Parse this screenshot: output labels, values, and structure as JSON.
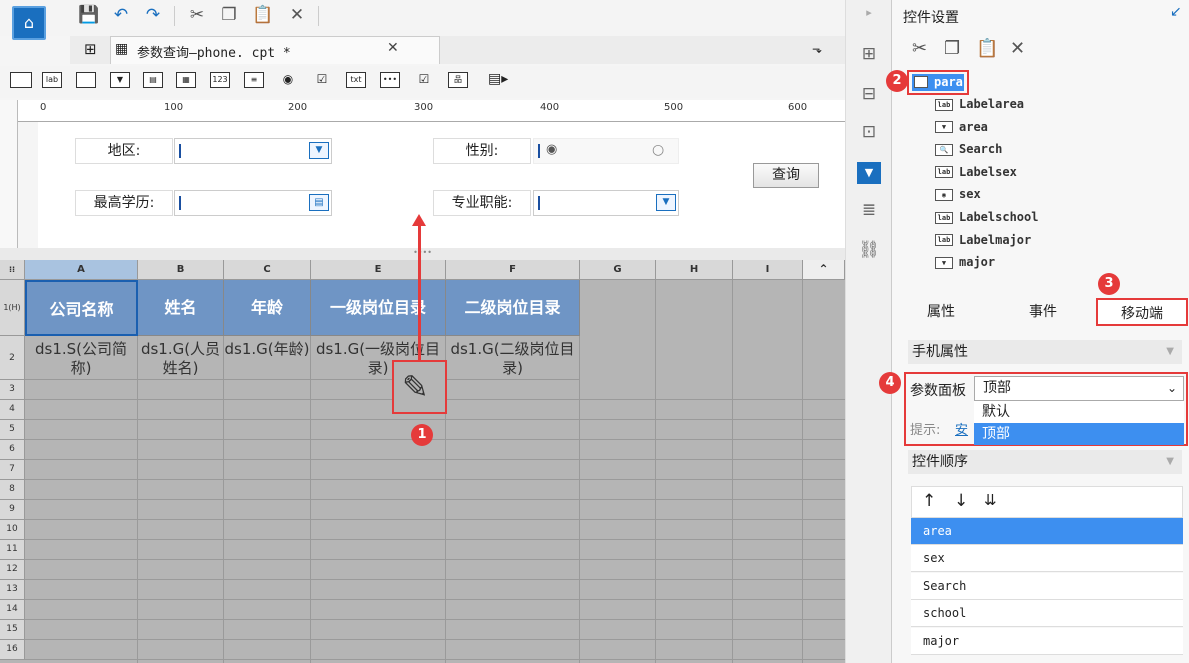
{
  "toolbar": {
    "save_icon": "save-icon",
    "undo_icon": "undo-icon",
    "redo_icon": "redo-icon",
    "cut_icon": "cut-icon",
    "copy_icon": "copy-icon",
    "paste_icon": "paste-icon",
    "delete_icon": "close-icon"
  },
  "tab": {
    "label": "参数查询—phone. cpt *",
    "close": "✕"
  },
  "widgets": [
    "lab",
    "123",
    "txt"
  ],
  "ruler": {
    "marks": [
      "0",
      "100",
      "200",
      "300",
      "400",
      "500",
      "600"
    ]
  },
  "params": {
    "area_label": "地区:",
    "sex_label": "性别:",
    "school_label": "最高学历:",
    "major_label": "专业职能:",
    "query_button": "查询"
  },
  "grid": {
    "columns": [
      "A",
      "B",
      "C",
      "E",
      "F",
      "G",
      "H",
      "I"
    ],
    "row1_label": "1(H)",
    "rows": [
      "2",
      "3",
      "4",
      "5",
      "6",
      "7",
      "8",
      "9",
      "10",
      "11",
      "12",
      "13",
      "14",
      "15",
      "16"
    ],
    "header_cells": [
      "公司名称",
      "姓名",
      "年龄",
      "一级岗位目录",
      "二级岗位目录"
    ],
    "data_cells": [
      "ds1.S(公司简称)",
      "ds1.G(人员姓名)",
      "ds1.G(年龄)",
      "ds1.G(一级岗位目录)",
      "ds1.G(二级岗位目录)"
    ]
  },
  "badges": [
    "1",
    "2",
    "3",
    "4"
  ],
  "panel": {
    "title": "控件设置",
    "tree": [
      {
        "icon": "lab",
        "name": "Labelarea"
      },
      {
        "icon": "▼",
        "name": "area"
      },
      {
        "icon": "🔍",
        "name": "Search"
      },
      {
        "icon": "lab",
        "name": "Labelsex"
      },
      {
        "icon": "◉",
        "name": "sex"
      },
      {
        "icon": "lab",
        "name": "Labelschool"
      },
      {
        "icon": "lab",
        "name": "Labelmajor"
      },
      {
        "icon": "▼",
        "name": "major"
      }
    ],
    "root": "para",
    "tabs": [
      "属性",
      "事件",
      "移动端"
    ],
    "mobile_section": "手机属性",
    "param_panel_label": "参数面板",
    "param_panel_value": "顶部",
    "dropdown_options": [
      "默认",
      "顶部"
    ],
    "hint_label": "提示:",
    "hint_link": "安",
    "order_section": "控件顺序",
    "order_items": [
      "area",
      "sex",
      "Search",
      "school",
      "major"
    ]
  },
  "colors": {
    "accent": "#1a6fbf",
    "header_fill": "#6f95c5",
    "selected": "#3d8ff0",
    "annot": "#e53a3a"
  }
}
